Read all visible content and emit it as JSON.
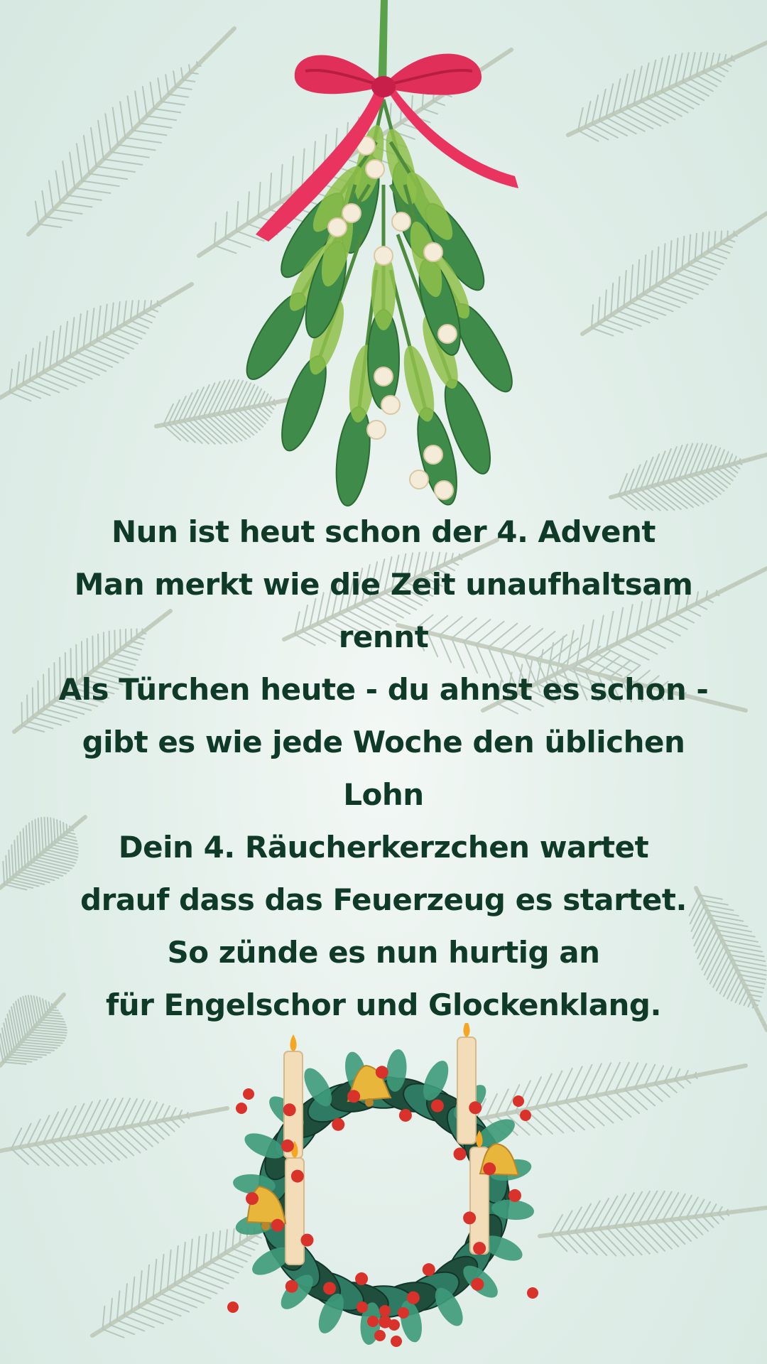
{
  "poem": {
    "lines": [
      "Nun ist heut schon der 4. Advent",
      "Man merkt wie die Zeit unaufhaltsam",
      "rennt",
      "Als Türchen heute - du ahnst es schon -",
      "gibt es wie jede Woche den üblichen",
      "Lohn",
      "Dein 4. Räucherkerzchen wartet",
      "drauf dass das Feuerzeug es startet.",
      "So zünde es nun hurtig an",
      "für Engelschor und Glockenklang."
    ]
  },
  "colors": {
    "text": "#0f3a28",
    "background": "#e3efea",
    "ribbon": "#e0305a",
    "mistletoe_leaf": "#3f8c4a",
    "wreath_leaf": "#2f7a63",
    "berry": "#d8322a",
    "candle": "#f3dcb8",
    "bell": "#e8b63a"
  },
  "decorations": {
    "top": "mistletoe-with-bow-icon",
    "bottom": "advent-wreath-icon",
    "background": "pine-branch-pattern"
  }
}
